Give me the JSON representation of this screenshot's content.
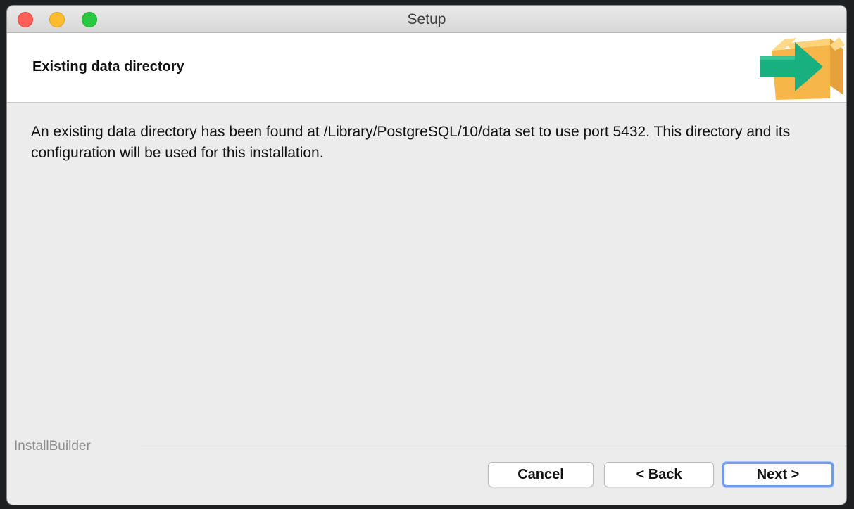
{
  "window": {
    "title": "Setup"
  },
  "header": {
    "title": "Existing data directory",
    "icon": "install-box-arrow-icon"
  },
  "main": {
    "message": "An existing data directory has been found at /Library/PostgreSQL/10/data set to use port 5432. This directory and its configuration will be used for this installation."
  },
  "footer": {
    "brand": "InstallBuilder",
    "cancel_label": "Cancel",
    "back_label": "< Back",
    "next_label": "Next >"
  },
  "colors": {
    "box": "#f7b64a",
    "arrow": "#18b07f",
    "focus": "#6c9bf0"
  }
}
